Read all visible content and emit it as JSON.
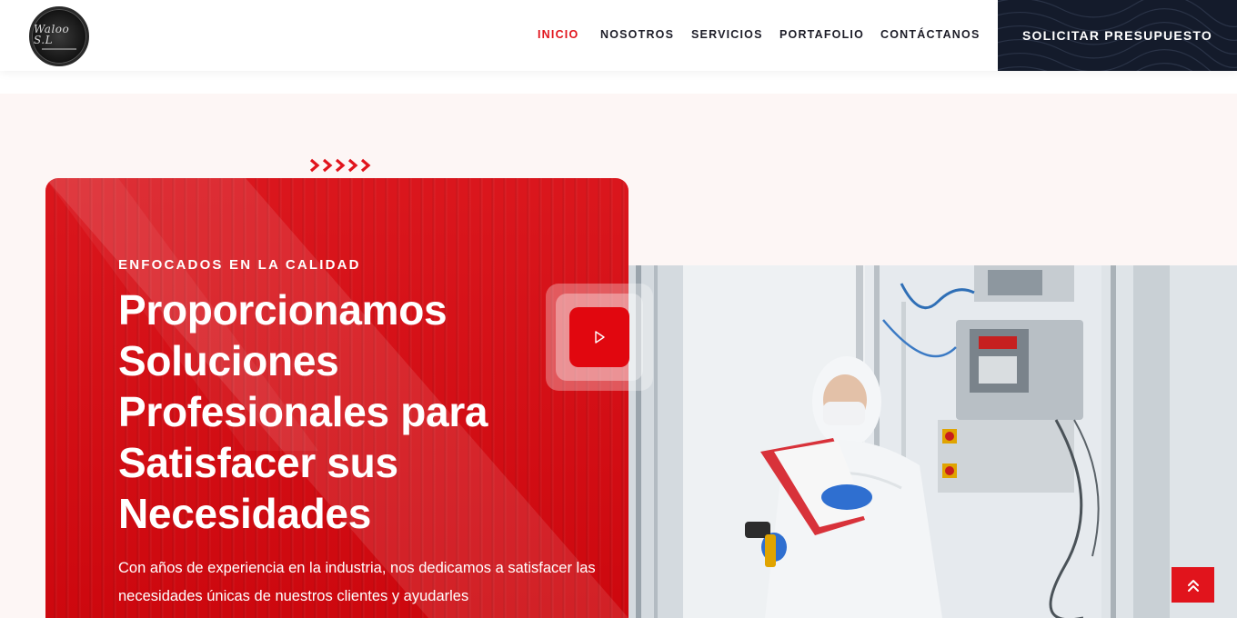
{
  "header": {
    "logo_text": "Waloo S.L",
    "nav": [
      {
        "label": "INICIO",
        "active": true
      },
      {
        "label": "NOSOTROS",
        "active": false
      },
      {
        "label": "SERVICIOS",
        "active": false
      },
      {
        "label": "PORTAFOLIO",
        "active": false
      },
      {
        "label": "CONTÁCTANOS",
        "active": false
      }
    ],
    "cta_label": "SOLICITAR PRESUPUESTO"
  },
  "hero": {
    "eyebrow": "ENFOCADOS EN LA CALIDAD",
    "title": "Proporcionamos Soluciones Profesionales para Satisfacer sus Necesidades",
    "description": "Con años de experiencia en la industria, nos dedicamos a satisfacer las necesidades únicas de nuestros clientes y ayudarles",
    "play_icon": "play-icon",
    "image_subject": "worker in white protective suit with clipboard and barcode scanner"
  },
  "colors": {
    "accent": "#e1141c",
    "dark": "#141b2b",
    "hero_bg": "#fdf6f5"
  },
  "scroll_top_icon": "double-chevron-up-icon"
}
